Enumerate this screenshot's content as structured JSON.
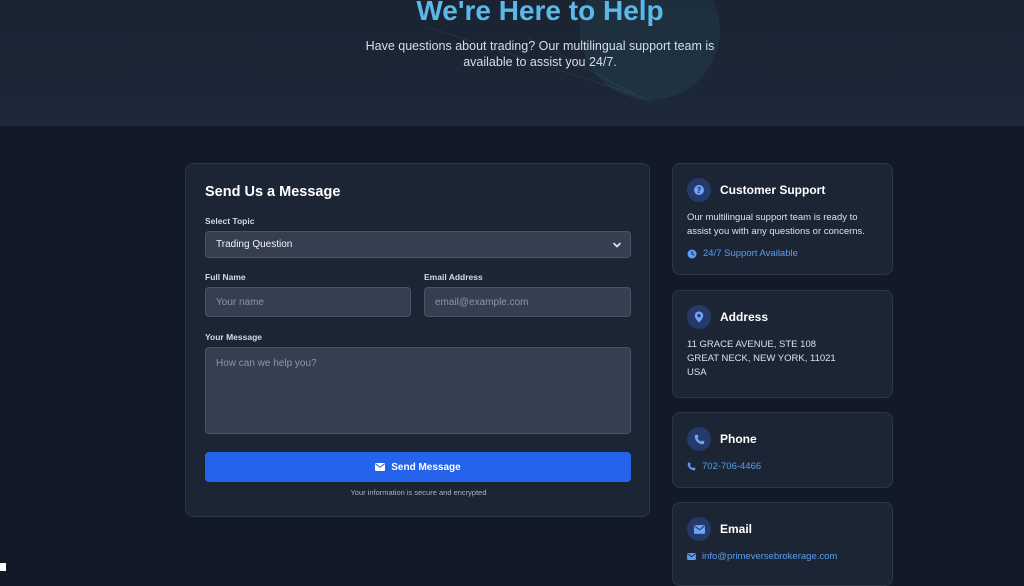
{
  "hero": {
    "title": "We're Here to Help",
    "subtitle": "Have questions about trading? Our multilingual support team is available to assist you 24/7."
  },
  "form": {
    "title": "Send Us a Message",
    "topic_label": "Select Topic",
    "topic_value": "Trading Question",
    "name_label": "Full Name",
    "name_placeholder": "Your name",
    "email_label": "Email Address",
    "email_placeholder": "email@example.com",
    "message_label": "Your Message",
    "message_placeholder": "How can we help you?",
    "send_label": "Send Message",
    "secure_note": "Your information is secure and encrypted"
  },
  "support": {
    "title": "Customer Support",
    "text": "Our multilingual support team is ready to assist you with any questions or concerns.",
    "link": "24/7 Support Available"
  },
  "address": {
    "title": "Address",
    "line1": "11 GRACE AVENUE, STE 108",
    "line2": "GREAT NECK, NEW YORK, 11021",
    "line3": "USA"
  },
  "phone": {
    "title": "Phone",
    "number": "702-706-4466"
  },
  "email": {
    "title": "Email",
    "address": "info@primeversebrokerage.com"
  },
  "colors": {
    "accent": "#2563eb",
    "title": "#5bb8e8",
    "link": "#5a9df2"
  },
  "icons": {
    "support": "question-icon",
    "address": "location-pin-icon",
    "phone": "phone-icon",
    "email": "envelope-icon",
    "clock": "clock-icon"
  }
}
